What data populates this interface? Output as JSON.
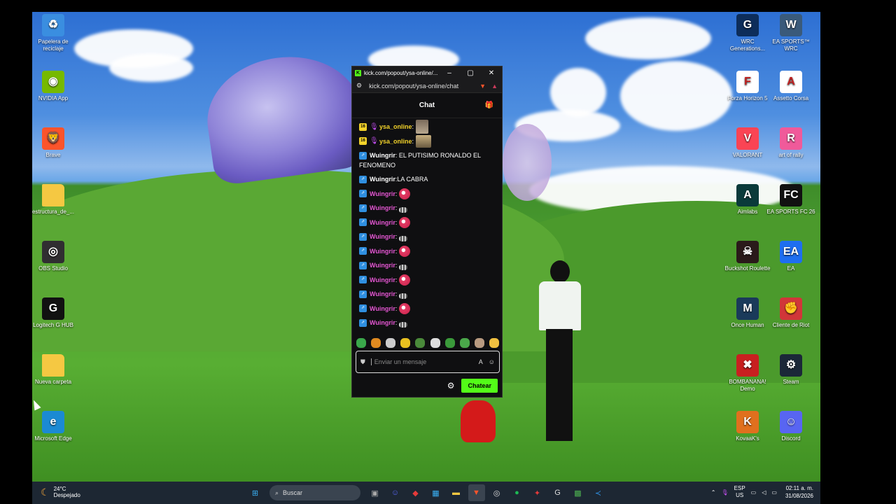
{
  "desktop_left": [
    {
      "label": "Papelera de reciclaje",
      "icon": "recycle-bin-icon",
      "color": "#3a8ee0",
      "glyph": "♻"
    },
    {
      "label": "NVIDIA App",
      "icon": "nvidia-icon",
      "color": "#76b900",
      "glyph": "◉"
    },
    {
      "label": "Brave",
      "icon": "brave-icon",
      "color": "#fb542b",
      "glyph": "🦁"
    },
    {
      "label": "estructura_de_...",
      "icon": "folder-icon",
      "color": "#f5c842",
      "glyph": ""
    },
    {
      "label": "OBS Studio",
      "icon": "obs-icon",
      "color": "#302e31",
      "glyph": "◎"
    },
    {
      "label": "Logitech G HUB",
      "icon": "logitech-icon",
      "color": "#111111",
      "glyph": "G"
    },
    {
      "label": "Nueva carpeta",
      "icon": "folder-icon",
      "color": "#f5c842",
      "glyph": ""
    },
    {
      "label": "Microsoft Edge",
      "icon": "edge-icon",
      "color": "#1b8ad3",
      "glyph": "e"
    }
  ],
  "desktop_right": [
    {
      "label": "WRC Generations...",
      "icon": "wrc-icon",
      "color": "#0d2d5a",
      "glyph": "G"
    },
    {
      "label": "EA SPORTS™ WRC",
      "icon": "ea-wrc-icon",
      "color": "#3a5a7a",
      "glyph": "W"
    },
    {
      "label": "Forza Horizon 5",
      "icon": "forza-icon",
      "color": "#ffffff",
      "glyph": "F"
    },
    {
      "label": "Assetto Corsa",
      "icon": "assetto-corsa-icon",
      "color": "#ffffff",
      "glyph": "A"
    },
    {
      "label": "VALORANT",
      "icon": "valorant-icon",
      "color": "#fa4454",
      "glyph": "V"
    },
    {
      "label": "art of rally",
      "icon": "art-of-rally-icon",
      "color": "#f05a9a",
      "glyph": "R"
    },
    {
      "label": "Aimlabs",
      "icon": "aimlabs-icon",
      "color": "#0a3a3a",
      "glyph": "A"
    },
    {
      "label": "EA SPORTS FC 26",
      "icon": "fc26-icon",
      "color": "#111111",
      "glyph": "FC"
    },
    {
      "label": "Buckshot Roulette",
      "icon": "buckshot-icon",
      "color": "#2a1a1a",
      "glyph": "☠"
    },
    {
      "label": "EA",
      "icon": "ea-icon",
      "color": "#1e6ef0",
      "glyph": "EA"
    },
    {
      "label": "Once Human",
      "icon": "once-human-icon",
      "color": "#1a3a5a",
      "glyph": "M"
    },
    {
      "label": "Cliente de Riot",
      "icon": "riot-icon",
      "color": "#d13639",
      "glyph": "✊"
    },
    {
      "label": "BOMBANANA! Demo",
      "icon": "bombanana-icon",
      "color": "#c82020",
      "glyph": "✖"
    },
    {
      "label": "Steam",
      "icon": "steam-icon",
      "color": "#1b2838",
      "glyph": "⚙"
    },
    {
      "label": "KovaaK's",
      "icon": "kovaaks-icon",
      "color": "#e0701e",
      "glyph": "K"
    },
    {
      "label": "Discord",
      "icon": "discord-icon",
      "color": "#5865f2",
      "glyph": "☺"
    }
  ],
  "chat_window": {
    "tab_title": "kick.com/popout/ysa-online/...",
    "url": "kick.com/popout/ysa-online/chat",
    "header": "Chat",
    "messages": [
      {
        "badges": [
          "16",
          "mic"
        ],
        "user": "ysa_online",
        "user_color": "#f2d22a",
        "text": "",
        "emote": "img"
      },
      {
        "badges": [
          "16",
          "mic"
        ],
        "user": "ysa_online",
        "user_color": "#f2d22a",
        "text": "",
        "emote": "img2"
      },
      {
        "badges": [
          "sub"
        ],
        "user": "Wuingrir",
        "user_color": "#ffffff",
        "text": "EL PUTISIMO RONALDO EL FENOMENO",
        "emote": "",
        "wrap": true
      },
      {
        "badges": [
          "sub"
        ],
        "user": "Wuingrir",
        "user_color": "#ffffff",
        "text": "LA CABRA",
        "emote": ""
      },
      {
        "badges": [
          "sub"
        ],
        "user": "Wuingrir",
        "user_color": "#e556d3",
        "text": "",
        "emote": "red"
      },
      {
        "badges": [
          "sub"
        ],
        "user": "Wuingrir",
        "user_color": "#e556d3",
        "text": "",
        "emote": "small"
      },
      {
        "badges": [
          "sub"
        ],
        "user": "Wuingrir",
        "user_color": "#e556d3",
        "text": "",
        "emote": "red"
      },
      {
        "badges": [
          "sub"
        ],
        "user": "Wuingrir",
        "user_color": "#e556d3",
        "text": "",
        "emote": "small"
      },
      {
        "badges": [
          "sub"
        ],
        "user": "Wuingrir",
        "user_color": "#e556d3",
        "text": "",
        "emote": "red"
      },
      {
        "badges": [
          "sub"
        ],
        "user": "Wuingrir",
        "user_color": "#e556d3",
        "text": "",
        "emote": "small"
      },
      {
        "badges": [
          "sub"
        ],
        "user": "Wuingrir",
        "user_color": "#e556d3",
        "text": "",
        "emote": "red"
      },
      {
        "badges": [
          "sub"
        ],
        "user": "Wuingrir",
        "user_color": "#e556d3",
        "text": "",
        "emote": "small"
      },
      {
        "badges": [
          "sub"
        ],
        "user": "Wuingrir",
        "user_color": "#e556d3",
        "text": "",
        "emote": "red"
      },
      {
        "badges": [
          "sub"
        ],
        "user": "Wuingrir",
        "user_color": "#e556d3",
        "text": "",
        "emote": "small"
      }
    ],
    "emote_bar_colors": [
      "#3aa84a",
      "#e08a20",
      "#cccccc",
      "#e8c020",
      "#4a8a3a",
      "#dddddd",
      "#3a9a3a",
      "#4aa84a",
      "#b89a80",
      "#f0c040"
    ],
    "input_placeholder": "Enviar un mensaje",
    "send_label": "Chatear",
    "accent": "#53fc18"
  },
  "taskbar": {
    "temp": "24°C",
    "condition": "Despejado",
    "search_placeholder": "Buscar",
    "lang_top": "ESP",
    "lang_bottom": "US",
    "time": "02:11 a. m.",
    "date": "31/08/2026"
  }
}
